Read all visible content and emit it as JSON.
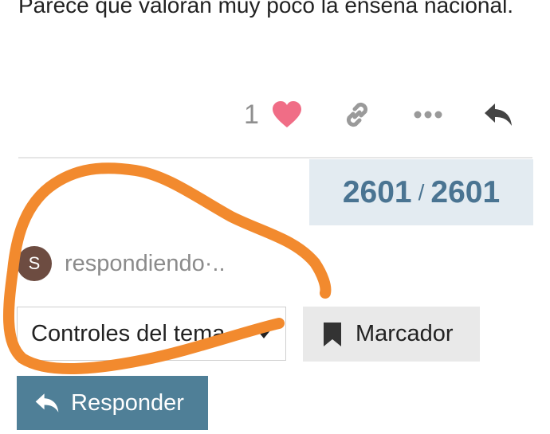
{
  "post": {
    "text": "Parece que valoran muy poco la enseña nacional."
  },
  "actions": {
    "like_count": "1",
    "heart_color": "#f06d86",
    "icons": [
      "heart-icon",
      "link-icon",
      "more-icon",
      "reply-arrow-icon"
    ]
  },
  "progress": {
    "current": "2601",
    "separator": "/",
    "total": "2601"
  },
  "replying": {
    "avatar_letter": "S",
    "text": "respondiendo·.."
  },
  "controls": {
    "topic_controls_label": "Controles del tema",
    "bookmark_label": "Marcador",
    "reply_label": "Responder"
  },
  "colors": {
    "accent": "#4f7f97",
    "progress_bg": "#e3ebf1",
    "annotation": "#f28a2e"
  }
}
